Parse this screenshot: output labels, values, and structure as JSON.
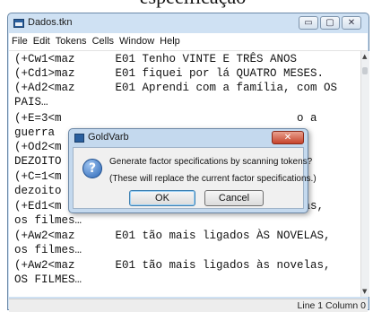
{
  "header_fragment": "especificação",
  "window": {
    "title": "Dados.tkn",
    "minimize": "▭",
    "maximize": "▢",
    "close": "✕"
  },
  "menu": [
    "File",
    "Edit",
    "Tokens",
    "Cells",
    "Window",
    "Help"
  ],
  "editor_lines": [
    "(+Cw1<maz      E01 Tenho VINTE E TRÊS ANOS",
    "(+Cd1>maz      E01 fiquei por lá QUATRO MESES.",
    "(+Ad2<maz      E01 Aprendi com a família, com OS",
    "PAIS…",
    "(+E=3<m                                   o a",
    "guerra",
    "(+Od2<m                                   S",
    "DEZOITO",
    "(+C=1<m                                   s",
    "dezoito",
    "(+Ed1<m                                   las,",
    "os filmes…",
    "(+Aw2<maz      E01 tão mais ligados ÀS NOVELAS,",
    "os filmes…",
    "(+Aw2<maz      E01 tão mais ligados às novelas,",
    "OS FILMES…"
  ],
  "scrollbar": {
    "up": "▲",
    "down": "▼"
  },
  "status": "Line 1 Column 0",
  "dialog": {
    "title": "GoldVarb",
    "close": "✕",
    "icon": "?",
    "message": "Generate factor specifications by scanning tokens?",
    "sub_message": "(These will replace the current factor specifications.)",
    "ok_label": "OK",
    "cancel_label": "Cancel"
  }
}
